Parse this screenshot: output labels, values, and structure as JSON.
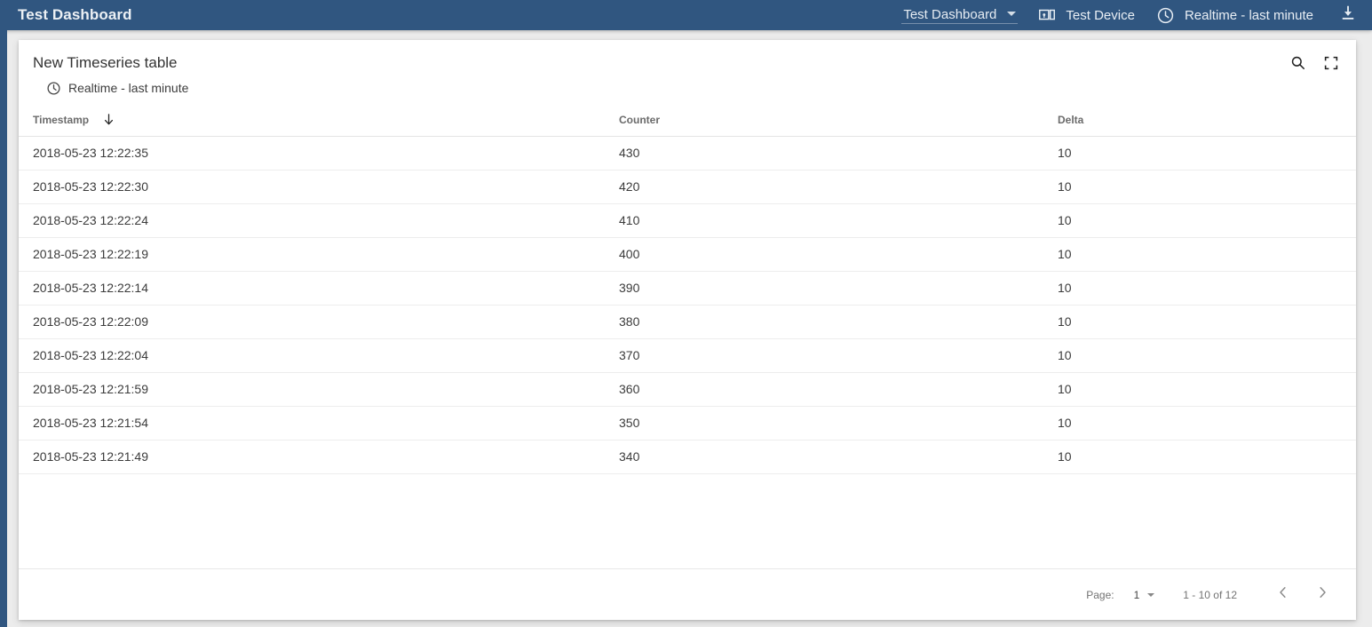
{
  "toolbar": {
    "title": "Test Dashboard",
    "dashboard_select": {
      "label": "Test Dashboard",
      "caret_icon": "chevron-down-icon"
    },
    "device": {
      "label": "Test Device",
      "icon": "devices-icon"
    },
    "timewindow": {
      "label": "Realtime - last minute",
      "icon": "clock-icon"
    },
    "download": {
      "icon": "download-icon"
    },
    "background_color": "#305680"
  },
  "card": {
    "title": "New Timeseries table",
    "subtitle": {
      "icon": "clock-icon",
      "text": "Realtime - last minute"
    },
    "actions": {
      "search_icon": "search-icon",
      "fullscreen_icon": "fullscreen-icon"
    }
  },
  "table": {
    "columns": [
      {
        "key": "timestamp",
        "label": "Timestamp",
        "sorted": true,
        "sort_icon": "arrow-down-icon"
      },
      {
        "key": "counter",
        "label": "Counter",
        "sorted": false
      },
      {
        "key": "delta",
        "label": "Delta",
        "sorted": false
      }
    ],
    "rows": [
      {
        "timestamp": "2018-05-23 12:22:35",
        "counter": "430",
        "delta": "10"
      },
      {
        "timestamp": "2018-05-23 12:22:30",
        "counter": "420",
        "delta": "10"
      },
      {
        "timestamp": "2018-05-23 12:22:24",
        "counter": "410",
        "delta": "10"
      },
      {
        "timestamp": "2018-05-23 12:22:19",
        "counter": "400",
        "delta": "10"
      },
      {
        "timestamp": "2018-05-23 12:22:14",
        "counter": "390",
        "delta": "10"
      },
      {
        "timestamp": "2018-05-23 12:22:09",
        "counter": "380",
        "delta": "10"
      },
      {
        "timestamp": "2018-05-23 12:22:04",
        "counter": "370",
        "delta": "10"
      },
      {
        "timestamp": "2018-05-23 12:21:59",
        "counter": "360",
        "delta": "10"
      },
      {
        "timestamp": "2018-05-23 12:21:54",
        "counter": "350",
        "delta": "10"
      },
      {
        "timestamp": "2018-05-23 12:21:49",
        "counter": "340",
        "delta": "10"
      }
    ]
  },
  "paginator": {
    "page_label": "Page:",
    "page_value": "1",
    "page_caret_icon": "chevron-down-icon",
    "range_label": "1 - 10 of 12",
    "prev_icon": "chevron-left-icon",
    "next_icon": "chevron-right-icon"
  }
}
